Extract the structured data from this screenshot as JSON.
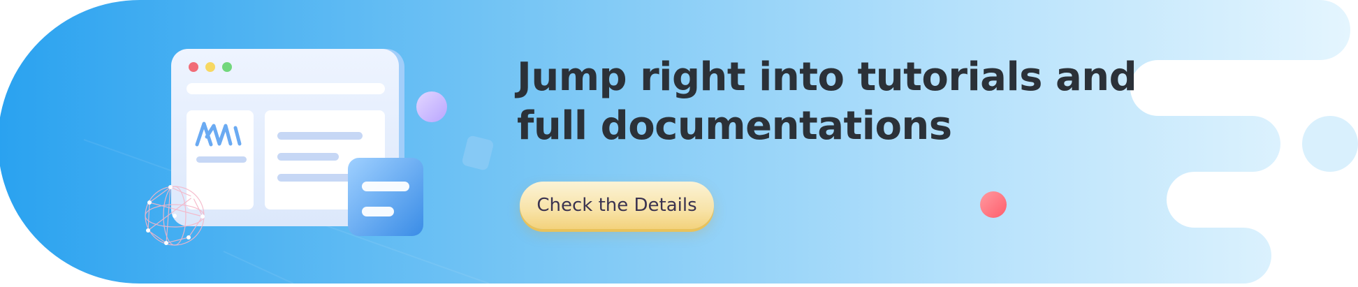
{
  "headline": {
    "line1": "Jump right into tutorials and",
    "line2": "full documentations"
  },
  "cta": {
    "label": "Check the Details"
  },
  "colors": {
    "banner_start": "#2aa2f0",
    "banner_end": "#e4f5fe",
    "headline_text": "#2b3138",
    "cta_fill": "#f8e3a8",
    "cta_text": "#3b3350",
    "accent_red": "#ff6b78",
    "accent_purple": "#c8b4ff"
  },
  "illustration": {
    "logo_text": "AWI"
  }
}
